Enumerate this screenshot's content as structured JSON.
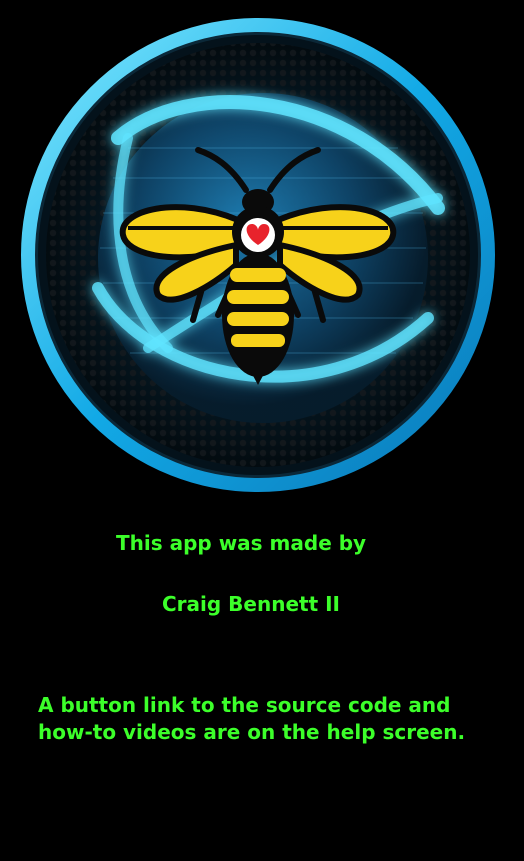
{
  "logo": {
    "icon": "bee-with-heart-globe-icon",
    "colors": {
      "ring": "#1ec8ff",
      "glow": "#7fe9ff",
      "bee_body": "#f7d21a",
      "bee_outline": "#0a0a0a",
      "heart": "#e8232c"
    }
  },
  "credits": {
    "made_by": "This app was made by",
    "author": "Craig Bennett II",
    "help_note": "A button link to the source code and how-to videos are on the help screen."
  },
  "text_color": "#3cff2a"
}
